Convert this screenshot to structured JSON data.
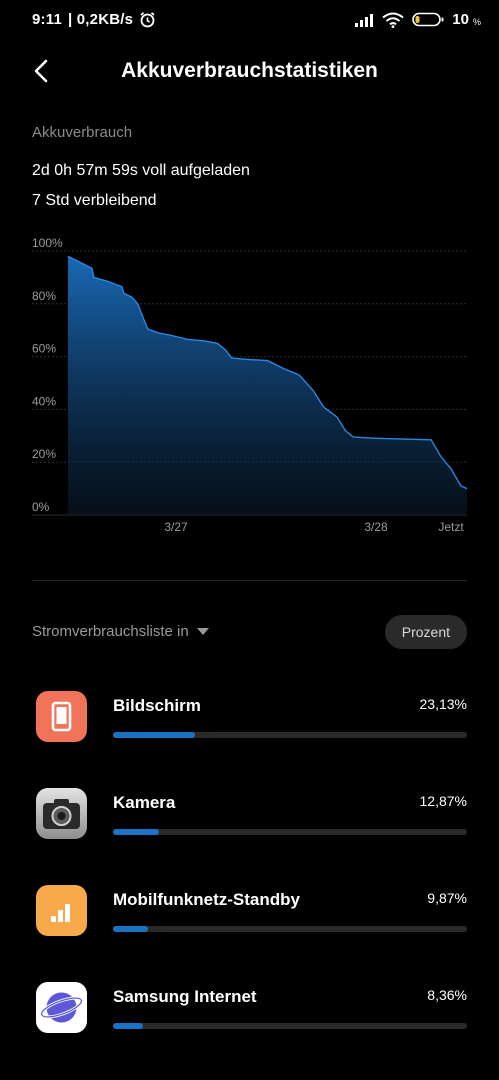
{
  "status_bar": {
    "time": "9:11",
    "speed": "| 0,2KB/s",
    "battery_level": "10",
    "battery_unit": "%"
  },
  "header": {
    "title": "Akkuverbrauchstatistiken"
  },
  "summary": {
    "section_label": "Akkuverbrauch",
    "charged_text": "2d 0h 57m 59s voll aufgeladen",
    "remaining_text": "7 Std verbleibend"
  },
  "chart_data": {
    "type": "area",
    "y_ticks": [
      "100%",
      "80%",
      "60%",
      "40%",
      "20%",
      "0%"
    ],
    "x_ticks": [
      "3/27",
      "3/28",
      "Jetzt"
    ],
    "ylim": [
      0,
      100
    ],
    "grid": true,
    "color": "#1a72c4",
    "series": [
      {
        "values": [
          [
            0,
            98
          ],
          [
            0.02,
            96.5
          ],
          [
            0.06,
            93.5
          ],
          [
            0.065,
            90
          ],
          [
            0.1,
            88.5
          ],
          [
            0.135,
            86.5
          ],
          [
            0.14,
            84
          ],
          [
            0.16,
            82.5
          ],
          [
            0.175,
            80
          ],
          [
            0.185,
            76
          ],
          [
            0.2,
            70.5
          ],
          [
            0.225,
            69
          ],
          [
            0.26,
            68
          ],
          [
            0.3,
            66.5
          ],
          [
            0.34,
            66
          ],
          [
            0.375,
            65
          ],
          [
            0.395,
            62.5
          ],
          [
            0.41,
            59.5
          ],
          [
            0.44,
            59
          ],
          [
            0.5,
            58.5
          ],
          [
            0.54,
            55.5
          ],
          [
            0.58,
            53
          ],
          [
            0.615,
            47
          ],
          [
            0.64,
            41
          ],
          [
            0.675,
            37
          ],
          [
            0.695,
            32
          ],
          [
            0.715,
            29.5
          ],
          [
            0.78,
            29
          ],
          [
            0.91,
            28.5
          ],
          [
            0.935,
            22
          ],
          [
            0.96,
            17.5
          ],
          [
            0.985,
            11
          ],
          [
            1.0,
            10
          ]
        ]
      }
    ]
  },
  "usage_list": {
    "header_label": "Stromverbrauchsliste in",
    "mode_button": "Prozent",
    "items": [
      {
        "name": "Bildschirm",
        "percent_text": "23,13%",
        "percent": 23.13,
        "icon": "screen-icon",
        "icon_color": "#f0735a"
      },
      {
        "name": "Kamera",
        "percent_text": "12,87%",
        "percent": 12.87,
        "icon": "camera-icon",
        "icon_color": "#3a3a3a"
      },
      {
        "name": "Mobilfunknetz-Standby",
        "percent_text": "9,87%",
        "percent": 9.87,
        "icon": "cell-signal-icon",
        "icon_color": "#f8a94a"
      },
      {
        "name": "Samsung Internet",
        "percent_text": "8,36%",
        "percent": 8.36,
        "icon": "samsung-internet-icon",
        "icon_color": "#6f6ce2"
      }
    ]
  }
}
